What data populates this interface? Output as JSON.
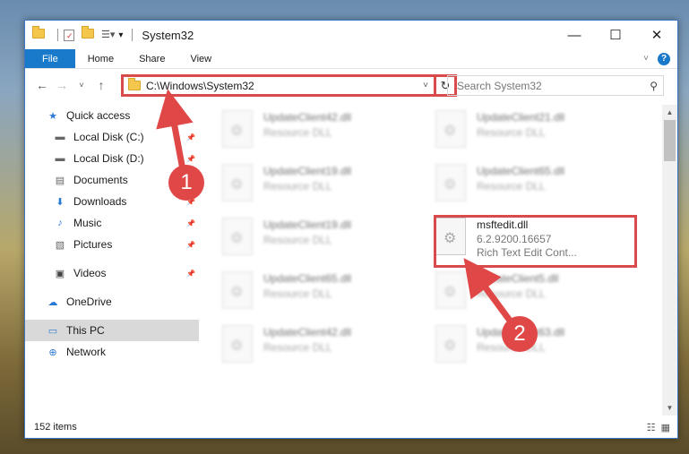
{
  "window": {
    "title": "System32"
  },
  "ribbon": {
    "tabs": [
      "File",
      "Home",
      "Share",
      "View"
    ]
  },
  "address": {
    "path": "C:\\Windows\\System32"
  },
  "search": {
    "placeholder": "Search System32"
  },
  "sidebar": {
    "items": [
      {
        "label": "Quick access",
        "icon": "star-icon",
        "indent": false,
        "pinned": false
      },
      {
        "label": "Local Disk (C:)",
        "icon": "drive-icon",
        "indent": true,
        "pinned": true
      },
      {
        "label": "Local Disk (D:)",
        "icon": "drive-icon",
        "indent": true,
        "pinned": true
      },
      {
        "label": "Documents",
        "icon": "document-icon",
        "indent": true,
        "pinned": true
      },
      {
        "label": "Downloads",
        "icon": "download-icon",
        "indent": true,
        "pinned": true
      },
      {
        "label": "Music",
        "icon": "music-icon",
        "indent": true,
        "pinned": true
      },
      {
        "label": "Pictures",
        "icon": "picture-icon",
        "indent": true,
        "pinned": true
      },
      {
        "label": "Videos",
        "icon": "video-icon",
        "indent": true,
        "pinned": true
      },
      {
        "label": "OneDrive",
        "icon": "cloud-icon",
        "indent": false,
        "pinned": false
      },
      {
        "label": "This PC",
        "icon": "computer-icon",
        "indent": false,
        "pinned": false,
        "selected": true
      },
      {
        "label": "Network",
        "icon": "network-icon",
        "indent": false,
        "pinned": false
      }
    ]
  },
  "files": [
    {
      "name": "UpdateClient42.dll",
      "desc": "Resource DLL",
      "blurred": true
    },
    {
      "name": "UpdateClient21.dll",
      "desc": "Resource DLL",
      "blurred": true
    },
    {
      "name": "UpdateClient19.dll",
      "desc": "Resource DLL",
      "blurred": true
    },
    {
      "name": "UpdateClient65.dll",
      "desc": "Resource DLL",
      "blurred": true
    },
    {
      "name": "UpdateClient19.dll",
      "desc": "Resource DLL",
      "blurred": true
    },
    {
      "name": "msftedit.dll",
      "version": "6.2.9200.16657",
      "desc": "Rich Text Edit Cont...",
      "blurred": false
    },
    {
      "name": "UpdateClient65.dll",
      "desc": "Resource DLL",
      "blurred": true
    },
    {
      "name": "UpdateClient5.dll",
      "desc": "Resource DLL",
      "blurred": true
    },
    {
      "name": "UpdateClient42.dll",
      "desc": "Resource DLL",
      "blurred": true
    },
    {
      "name": "UpdateClient63.dll",
      "desc": "Resource DLL",
      "blurred": true
    }
  ],
  "status": {
    "item_count": "152 items"
  },
  "annotations": {
    "badge1": "1",
    "badge2": "2",
    "color": "#e04848"
  }
}
